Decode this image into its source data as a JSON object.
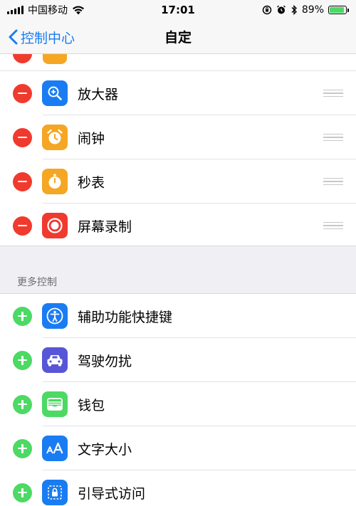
{
  "status_bar": {
    "carrier": "中国移动",
    "time": "17:01",
    "battery_percent": "89%",
    "battery_level": 0.89
  },
  "nav": {
    "back_label": "控制中心",
    "title": "自定"
  },
  "included_controls": [
    {
      "label": "放大器",
      "icon": "magnifier-icon",
      "color": "#1a7cf2"
    },
    {
      "label": "闹钟",
      "icon": "alarm-clock-icon",
      "color": "#f5a623"
    },
    {
      "label": "秒表",
      "icon": "stopwatch-icon",
      "color": "#f5a623"
    },
    {
      "label": "屏幕录制",
      "icon": "screen-record-icon",
      "color": "#f03a2e"
    }
  ],
  "more_controls": {
    "header": "更多控制",
    "items": [
      {
        "label": "辅助功能快捷键",
        "icon": "accessibility-icon",
        "color": "#1a7cf2"
      },
      {
        "label": "驾驶勿扰",
        "icon": "car-icon",
        "color": "#5856d6"
      },
      {
        "label": "钱包",
        "icon": "wallet-icon",
        "color": "#4cd964"
      },
      {
        "label": "文字大小",
        "icon": "text-size-icon",
        "color": "#1a7cf2"
      },
      {
        "label": "引导式访问",
        "icon": "lock-icon",
        "color": "#1a7cf2"
      }
    ]
  }
}
